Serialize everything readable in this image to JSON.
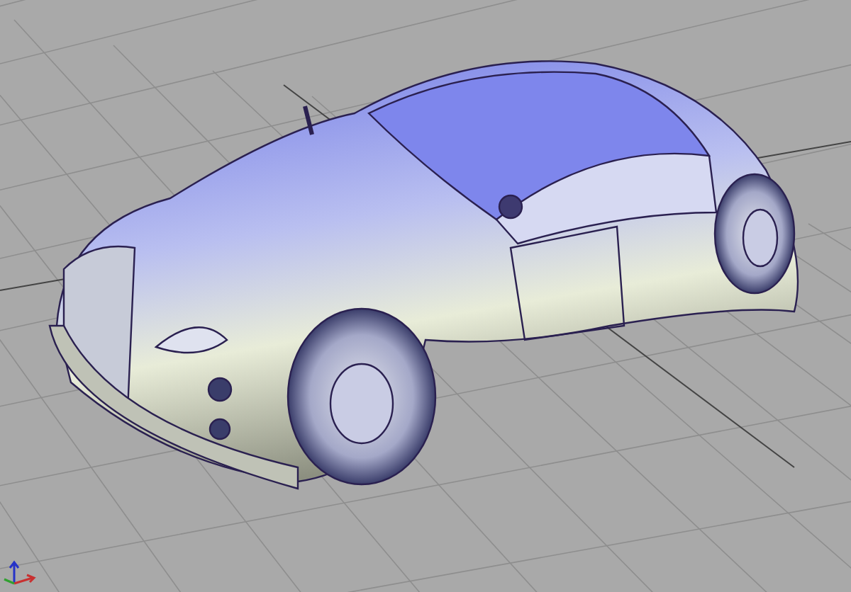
{
  "viewport": {
    "axes": true
  }
}
